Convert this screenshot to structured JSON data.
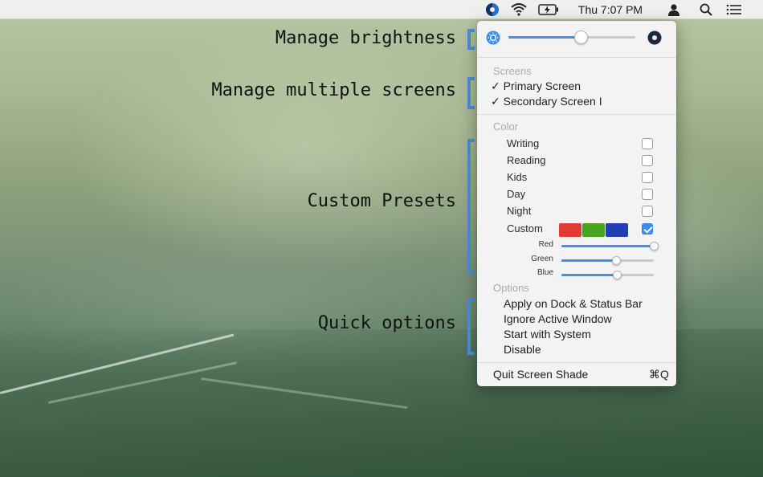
{
  "menubar": {
    "clock": "Thu 7:07 PM",
    "icons": [
      "screen-shade-icon",
      "wifi-icon",
      "battery-icon",
      "user-icon",
      "search-icon",
      "list-icon"
    ]
  },
  "callouts": {
    "brightness": "Manage brightness",
    "screens": "Manage multiple screens",
    "presets": "Custom Presets",
    "options": "Quick options"
  },
  "panel": {
    "brightness": {
      "value": 0.57,
      "min_icon": "sun-icon",
      "max_icon": "moon-icon"
    },
    "screens": {
      "title": "Screens",
      "items": [
        {
          "label": "✓ Primary Screen",
          "checked": true
        },
        {
          "label": "✓ Secondary Screen I",
          "checked": true
        }
      ]
    },
    "color": {
      "title": "Color",
      "presets": [
        {
          "label": "Writing",
          "checked": false
        },
        {
          "label": "Reading",
          "checked": false
        },
        {
          "label": "Kids",
          "checked": false
        },
        {
          "label": "Day",
          "checked": false
        },
        {
          "label": "Night",
          "checked": false
        },
        {
          "label": "Custom",
          "checked": true
        }
      ],
      "swatches": [
        "#e23b34",
        "#4aa51c",
        "#1f3fb6"
      ],
      "accent": "#3d8ff1",
      "rgb": [
        {
          "label": "Red",
          "value": 1.0
        },
        {
          "label": "Green",
          "value": 0.59
        },
        {
          "label": "Blue",
          "value": 0.6
        }
      ]
    },
    "options": {
      "title": "Options",
      "items": [
        "Apply on Dock & Status Bar",
        "Ignore Active Window",
        "Start with System",
        "Disable"
      ]
    },
    "quit": {
      "label": "Quit Screen Shade",
      "shortcut": "⌘Q"
    }
  }
}
